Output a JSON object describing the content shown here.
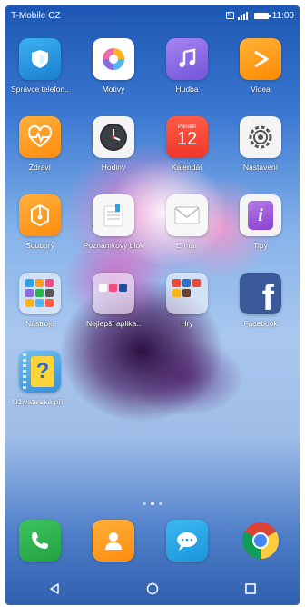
{
  "status_bar": {
    "carrier": "T-Mobile CZ",
    "time": "11:00"
  },
  "apps": [
    {
      "label": "Správce telefon..",
      "icon": "shield-icon",
      "color": "#2a9be0"
    },
    {
      "label": "Motivy",
      "icon": "theme-brush-icon",
      "color": "#ffffff"
    },
    {
      "label": "Hudba",
      "icon": "music-note-icon",
      "color": "#8b6ce6"
    },
    {
      "label": "Videa",
      "icon": "play-icon",
      "color": "#ff9c1a"
    },
    {
      "label": "Zdraví",
      "icon": "heart-icon",
      "color": "#ff9d1f"
    },
    {
      "label": "Hodiny",
      "icon": "clock-icon",
      "color": "#ffffff"
    },
    {
      "label": "Kalendář",
      "icon": "calendar-icon",
      "color": "#ff4a3d",
      "calendar_day_name": "Pondělí",
      "calendar_day_number": "12"
    },
    {
      "label": "Nastavení",
      "icon": "gear-icon",
      "color": "#ffffff"
    },
    {
      "label": "Soubory",
      "icon": "folder-icon",
      "color": "#ff9d1f"
    },
    {
      "label": "Poznámkový blok",
      "icon": "notepad-icon",
      "color": "#ffffff"
    },
    {
      "label": "E-mail",
      "icon": "mail-icon",
      "color": "#ffffff"
    },
    {
      "label": "Tipy",
      "icon": "info-icon",
      "color": "#9b59d6"
    },
    {
      "label": "Nástroje",
      "icon": "tools-folder-icon",
      "color": "#ffffff"
    },
    {
      "label": "Nejlepší aplika..",
      "icon": "top-apps-folder-icon",
      "color": "#ffffff"
    },
    {
      "label": "Hry",
      "icon": "games-folder-icon",
      "color": "#ffffff"
    },
    {
      "label": "Facebook",
      "icon": "facebook-icon",
      "color": "#3b5998"
    },
    {
      "label": "Uživatelská pří..",
      "icon": "user-guide-icon",
      "color": "#4aa3df"
    }
  ],
  "page_indicator": {
    "count": 3,
    "active": 2
  },
  "dock": [
    {
      "name": "phone",
      "icon": "phone-icon",
      "color": "#2bb24c"
    },
    {
      "name": "contacts",
      "icon": "contacts-icon",
      "color": "#ff9d1f"
    },
    {
      "name": "messages",
      "icon": "messages-icon",
      "color": "#2aa8e8"
    },
    {
      "name": "chrome",
      "icon": "chrome-icon",
      "color": "#ffffff"
    }
  ]
}
